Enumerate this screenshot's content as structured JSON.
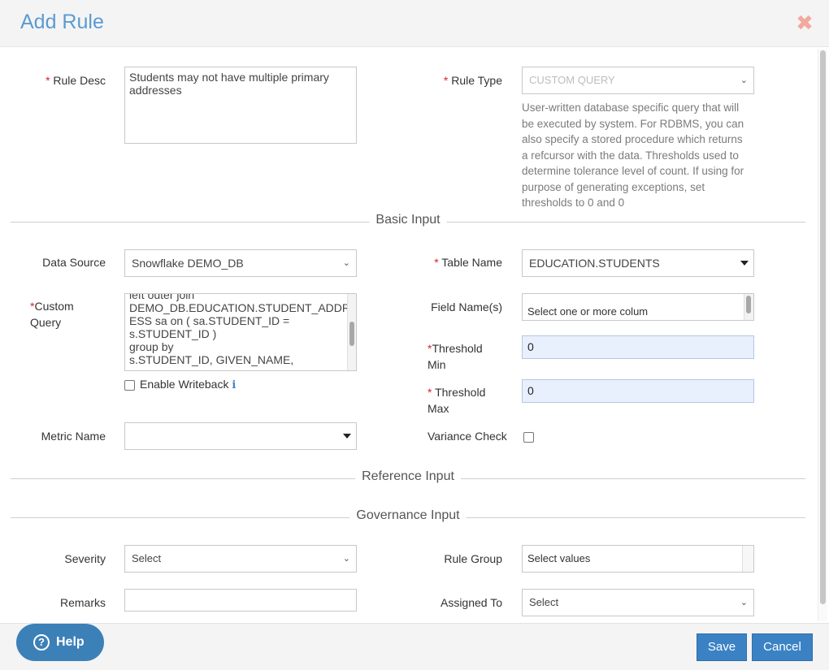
{
  "dialog": {
    "title": "Add Rule"
  },
  "rule_desc": {
    "label": "Rule Desc",
    "required_mark": "*",
    "value_line1": "Students may not have multiple primary",
    "value_line2": "addresses"
  },
  "rule_type": {
    "label": "Rule Type",
    "required_mark": "*",
    "value": "CUSTOM QUERY",
    "help_lines": [
      "User-written database specific query that will",
      "be executed by system. For RDBMS, you can",
      "also specify a stored procedure which returns",
      "a refcursor with the data. Thresholds used to",
      "determine tolerance level of count. If using for",
      "purpose of generating exceptions, set",
      "thresholds to 0 and 0"
    ]
  },
  "sections": {
    "basic": "Basic Input",
    "reference": "Reference Input",
    "governance": "Governance Input"
  },
  "data_source": {
    "label": "Data Source",
    "value": "Snowflake DEMO_DB"
  },
  "table_name": {
    "label": "Table Name",
    "required_mark": "*",
    "value": "EDUCATION.STUDENTS"
  },
  "custom_query": {
    "label_line1": "Custom",
    "label_line2": "Query",
    "required_mark": "*",
    "lines": [
      "left outer join",
      "DEMO_DB.EDUCATION.STUDENT_ADDR",
      "ESS sa on ( sa.STUDENT_ID =",
      "s.STUDENT_ID )",
      "group by",
      "s.STUDENT_ID, GIVEN_NAME,"
    ]
  },
  "field_names": {
    "label": "Field Name(s)",
    "placeholder": "Select one or more colum"
  },
  "enable_writeback": {
    "label": "Enable Writeback",
    "info_icon": "i"
  },
  "threshold_min": {
    "label_line1": "Threshold",
    "label_line2": "Min",
    "required_mark": "*",
    "value": "0"
  },
  "threshold_max": {
    "label_line1": "Threshold",
    "label_line2": "Max",
    "required_mark": "*",
    "value": "0"
  },
  "metric_name": {
    "label": "Metric Name",
    "value": ""
  },
  "variance_check": {
    "label": "Variance Check"
  },
  "severity": {
    "label": "Severity",
    "value": "Select"
  },
  "rule_group": {
    "label": "Rule Group",
    "value": "Select values"
  },
  "remarks": {
    "label": "Remarks",
    "value": ""
  },
  "assigned_to": {
    "label": "Assigned To",
    "value": "Select"
  },
  "footer": {
    "help": "Help",
    "help_icon": "?",
    "save": "Save",
    "cancel": "Cancel"
  }
}
